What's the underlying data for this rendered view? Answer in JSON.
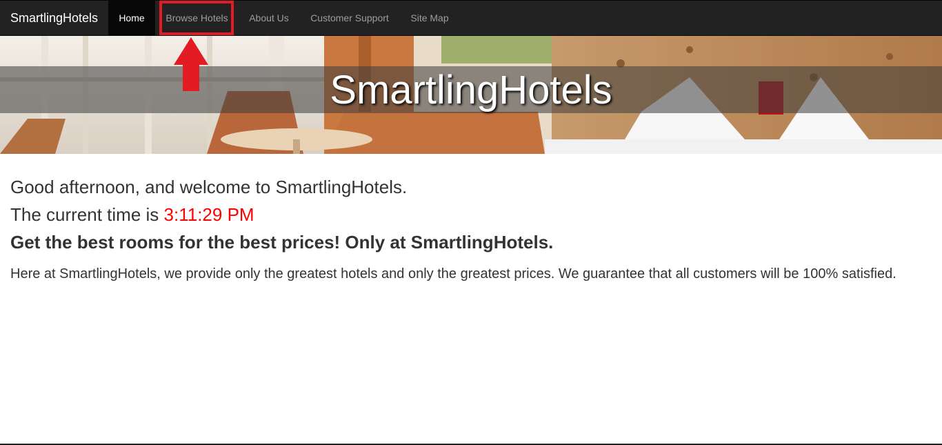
{
  "navbar": {
    "brand": "SmartlingHotels",
    "items": [
      {
        "label": "Home",
        "active": true
      },
      {
        "label": "Browse Hotels",
        "active": false
      },
      {
        "label": "About Us",
        "active": false
      },
      {
        "label": "Customer Support",
        "active": false
      },
      {
        "label": "Site Map",
        "active": false
      }
    ]
  },
  "annotation": {
    "highlight_color": "#e31b23",
    "arrow_icon": "up-arrow-icon"
  },
  "hero": {
    "title": "SmartlingHotels"
  },
  "main": {
    "greeting": "Good afternoon, and welcome to SmartlingHotels.",
    "time_prefix": "The current time is",
    "time_value": "3:11:29 PM",
    "time_color": "#ff0000",
    "tagline": "Get the best rooms for the best prices! Only at SmartlingHotels.",
    "description": "Here at SmartlingHotels, we provide only the greatest hotels and only the greatest prices. We guarantee that all customers will be 100% satisfied."
  }
}
